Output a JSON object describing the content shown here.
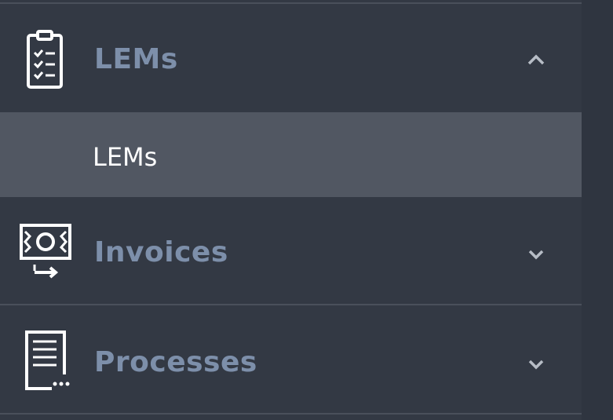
{
  "sidebar": {
    "groups": [
      {
        "label": "LEMs",
        "icon": "clipboard-checklist-icon",
        "expanded": true,
        "items": [
          {
            "label": "LEMs",
            "active": true
          }
        ]
      },
      {
        "label": "Invoices",
        "icon": "money-transfer-icon",
        "expanded": false
      },
      {
        "label": "Processes",
        "icon": "document-list-icon",
        "expanded": false
      }
    ]
  },
  "colors": {
    "background": "#333944",
    "active_item": "#515762",
    "label": "#7d8faa",
    "active_label": "#ffffff",
    "divider": "#4a505b"
  }
}
